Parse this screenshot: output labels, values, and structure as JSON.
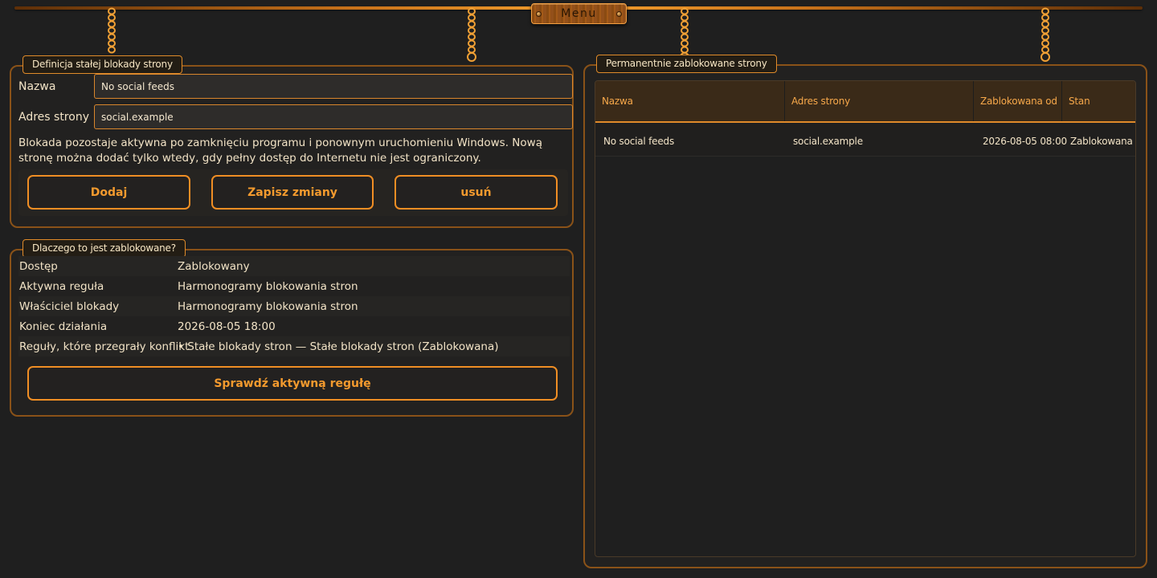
{
  "menu": {
    "label": "Menu"
  },
  "form_panel": {
    "title": "Definicja stałej blokady strony",
    "name_label": "Nazwa",
    "name_value": "No social feeds",
    "address_label": "Adres strony",
    "address_value": "social.example",
    "info": "Blokada pozostaje aktywna po zamknięciu programu i ponownym uruchomieniu Windows. Nową stronę można dodać tylko wtedy, gdy pełny dostęp do Internetu nie jest ograniczony.",
    "buttons": {
      "add": "Dodaj",
      "save": "Zapisz zmiany",
      "remove": "usuń"
    }
  },
  "why_panel": {
    "title": "Dlaczego to jest zablokowane?",
    "rows": [
      {
        "key": "Dostęp",
        "value": "Zablokowany"
      },
      {
        "key": "Aktywna reguła",
        "value": "Harmonogramy blokowania stron"
      },
      {
        "key": "Właściciel blokady",
        "value": "Harmonogramy blokowania stron"
      },
      {
        "key": "Koniec działania",
        "value": "2026-08-05 18:00"
      },
      {
        "key": "Reguły, które przegrały konflikt",
        "value": "• Stałe blokady stron — Stałe blokady stron (Zablokowana)"
      }
    ],
    "check_button": "Sprawdź aktywną regułę"
  },
  "table_panel": {
    "title": "Permanentnie zablokowane strony",
    "columns": [
      "Nazwa",
      "Adres strony",
      "Zablokowana od",
      "Stan"
    ],
    "rows": [
      [
        "No social feeds",
        "social.example",
        "2026-08-05 08:00",
        "Zablokowana"
      ]
    ]
  },
  "colors": {
    "background": "#1f1f1f",
    "accent": "#f08e24",
    "panel_border": "#8a5218",
    "text": "#f2e3c6"
  }
}
